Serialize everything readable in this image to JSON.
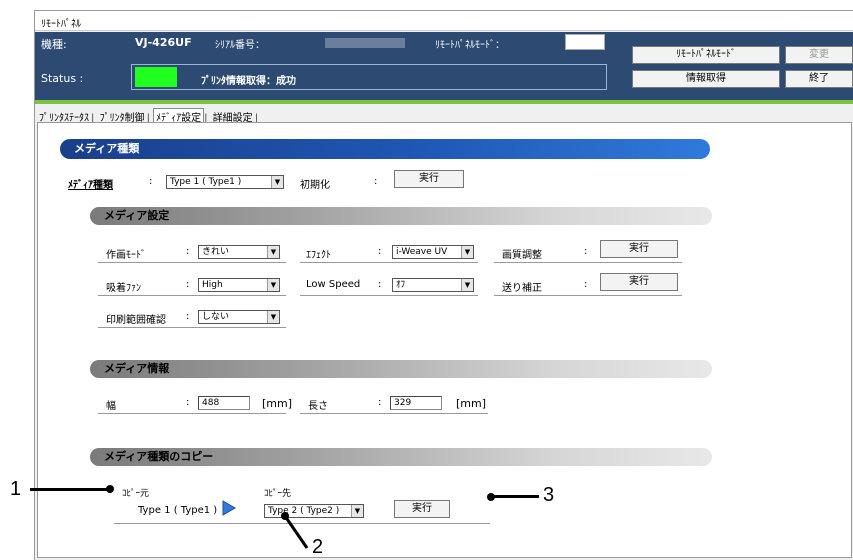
{
  "window": {
    "title": "ﾘﾓｰﾄﾊﾟﾈﾙ"
  },
  "header": {
    "model_label": "機種:",
    "model_value": "VJ-426UF",
    "serial_label": "ｼﾘｱﾙ番号：",
    "remote_mode_label": "ﾘﾓｰﾄﾊﾟﾈﾙﾓｰﾄﾞ：",
    "status_label": "Status :",
    "status_text": "ﾌﾟﾘﾝﾀ情報取得：成功",
    "status_color": "#20ff20",
    "buttons": {
      "remote_mode": "ﾘﾓｰﾄﾊﾟﾈﾙﾓｰﾄﾞ",
      "change": "変更",
      "get_info": "情報取得",
      "exit": "終了"
    }
  },
  "tabs": [
    {
      "label": "ﾌﾟﾘﾝﾀｽﾃｰﾀｽ"
    },
    {
      "label": "ﾌﾟﾘﾝﾀ制御"
    },
    {
      "label": "ﾒﾃﾞｨｱ設定"
    },
    {
      "label": "詳細設定"
    }
  ],
  "media_type": {
    "section_title": "メディア種類",
    "label": "ﾒﾃﾞｨｱ種類",
    "colon": ":",
    "value": "Type 1 ( Type1 )",
    "init_label": "初期化",
    "execute": "実行"
  },
  "media_settings": {
    "section_title": "メディア設定",
    "draw_mode_label": "作画ﾓｰﾄﾞ",
    "draw_mode_value": "きれい",
    "effect_label": "ｴﾌｪｸﾄ",
    "effect_value": "i-Weave UV",
    "quality_label": "画質調整",
    "quality_button": "実行",
    "fan_label": "吸着ﾌｧﾝ",
    "fan_value": "High",
    "low_speed_label": "Low Speed",
    "low_speed_value": "ｵﾌ",
    "feed_label": "送り補正",
    "feed_button": "実行",
    "print_range_label": "印刷範囲確認",
    "print_range_value": "しない"
  },
  "media_info": {
    "section_title": "メディア情報",
    "width_label": "幅",
    "width_value": "488",
    "length_label": "長さ",
    "length_value": "329",
    "unit": "[mm]"
  },
  "media_copy": {
    "section_title": "メディア種類のコピー",
    "source_label": "ｺﾋﾟｰ元",
    "source_value": "Type 1 ( Type1 )",
    "dest_label": "ｺﾋﾟｰ先",
    "dest_value": "Type 2 ( Type2 )",
    "execute": "実行",
    "arrow_color": "#2f7adb"
  },
  "callouts": {
    "c1": "1",
    "c2": "2",
    "c3": "3"
  }
}
